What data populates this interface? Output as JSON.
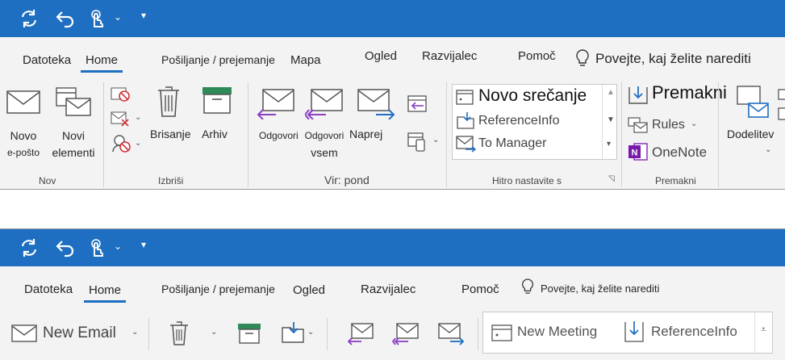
{
  "top": {
    "tabs": [
      {
        "label": "Datoteka"
      },
      {
        "label": "Home"
      },
      {
        "label": "Pošiljanje / prejemanje"
      },
      {
        "label": "Mapa"
      },
      {
        "label": "Ogled"
      },
      {
        "label": "Razvijalec"
      },
      {
        "label": "Pomoč"
      }
    ],
    "tell_me": "Povejte, kaj želite narediti",
    "ribbon": {
      "new_email_l1": "Novo",
      "new_email_l2": "e-pošto",
      "new_items_l1": "Novi",
      "new_items_l2": "elementi",
      "group_new": "Nov",
      "delete_label": "Brisanje",
      "archive_label": "Arhiv",
      "group_delete": "Izbriši",
      "reply_label": "Odgovori",
      "reply_all_l1": "Odgovori",
      "reply_all_l2": "vsem",
      "forward_label": "Naprej",
      "group_respond": "Vir: pond",
      "quick_steps": [
        "Novo srečanje",
        "ReferenceInfo",
        "To Manager"
      ],
      "group_quicksteps": "Hitro nastavite s",
      "move_label": "Premakni",
      "rules_label": "Rules",
      "onenote_label": "OneNote",
      "group_move": "Premakni",
      "assign_label": "Dodelitev"
    }
  },
  "bottom": {
    "tabs": [
      {
        "label": "Datoteka"
      },
      {
        "label": "Home"
      },
      {
        "label": "Pošiljanje / prejemanje"
      },
      {
        "label": "Ogled"
      },
      {
        "label": "Razvijalec"
      },
      {
        "label": "Pomoč"
      }
    ],
    "tell_me": "Povejte, kaj želite narediti",
    "ribbon": {
      "new_email_label": "New Email",
      "quick_steps": [
        "New Meeting",
        "ReferenceInfo"
      ]
    }
  },
  "colors": {
    "title_bar": "#1e6fc1",
    "ribbon_bg": "#f3f3f3",
    "accent": "#1e6fc1",
    "reply_purple": "#8a3fc5",
    "archive_green": "#2e8b57",
    "delete_red": "#d13438",
    "onenote_purple": "#7719aa"
  }
}
